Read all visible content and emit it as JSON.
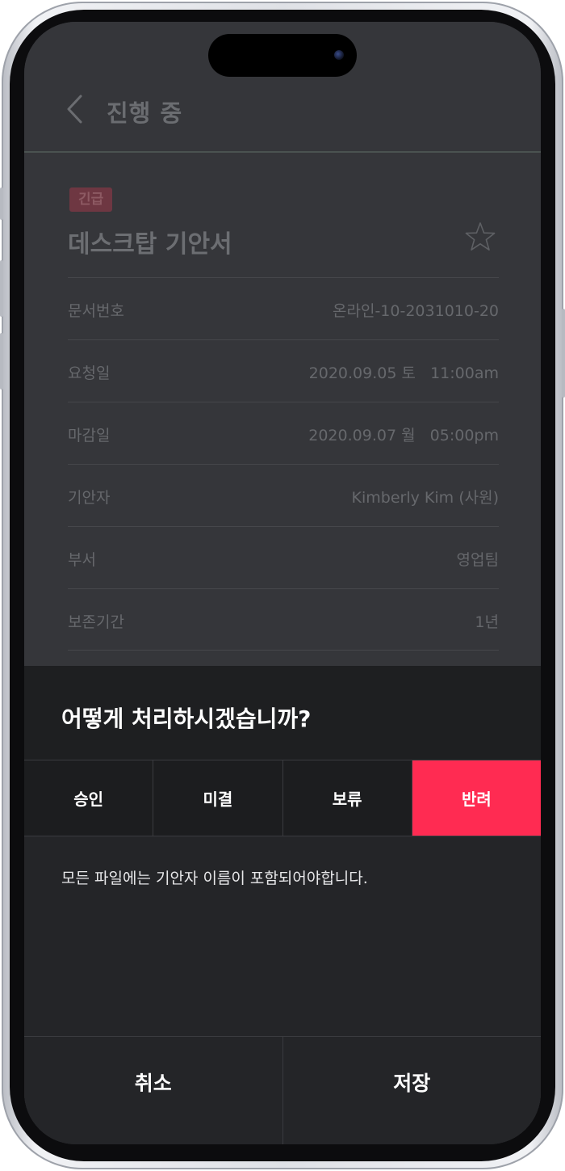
{
  "header": {
    "title": "진행 중",
    "back_icon": "chevron-left-icon"
  },
  "document": {
    "badge": "긴급",
    "title": "데스크탑 기안서",
    "favorite_icon": "star-outline-icon",
    "fields": [
      {
        "label": "문서번호",
        "value": "온라인-10-2031010-20"
      },
      {
        "label": "요청일",
        "value": "2020.09.05 토   11:00am"
      },
      {
        "label": "마감일",
        "value": "2020.09.07 월   05:00pm"
      },
      {
        "label": "기안자",
        "value": "Kimberly Kim (사원)"
      },
      {
        "label": "부서",
        "value": "영업팀"
      },
      {
        "label": "보존기간",
        "value": "1년"
      }
    ]
  },
  "sheet": {
    "title": "어떻게 처리하시겠습니까?",
    "options": [
      {
        "label": "승인",
        "selected": false
      },
      {
        "label": "미결",
        "selected": false
      },
      {
        "label": "보류",
        "selected": false
      },
      {
        "label": "반려",
        "selected": true
      }
    ],
    "note": "모든 파일에는 기안자 이름이 포함되어야합니다.",
    "cancel_label": "취소",
    "save_label": "저장"
  },
  "colors": {
    "accent": "#ff2b52",
    "badge_bg": "#6e3742"
  }
}
